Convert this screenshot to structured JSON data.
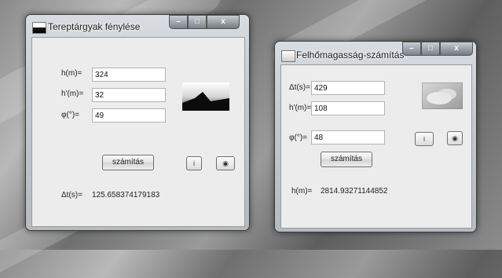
{
  "window1": {
    "title": "Tereptárgyak fénylése",
    "h_label": "h(m)=",
    "h_value": "324",
    "hp_label": "h'(m)=",
    "hp_value": "32",
    "phi_label": "φ(°)=",
    "phi_value": "49",
    "calc_label": "számítás",
    "info_label": "i",
    "eye_label": "◉",
    "result_label": "Δt(s)=",
    "result_value": "125.658374179183"
  },
  "window2": {
    "title": "Felhőmagasság-számítás",
    "dt_label": "Δt(s)=",
    "dt_value": "429",
    "hp_label": "h'(m)=",
    "hp_value": "108",
    "phi_label": "φ(°)=",
    "phi_value": "48",
    "calc_label": "számítás",
    "info_label": "i",
    "eye_label": "◉",
    "result_label": "h(m)=",
    "result_value": "2814.93271144852"
  },
  "controls": {
    "minimize": "–",
    "maximize": "□",
    "close": "x"
  }
}
